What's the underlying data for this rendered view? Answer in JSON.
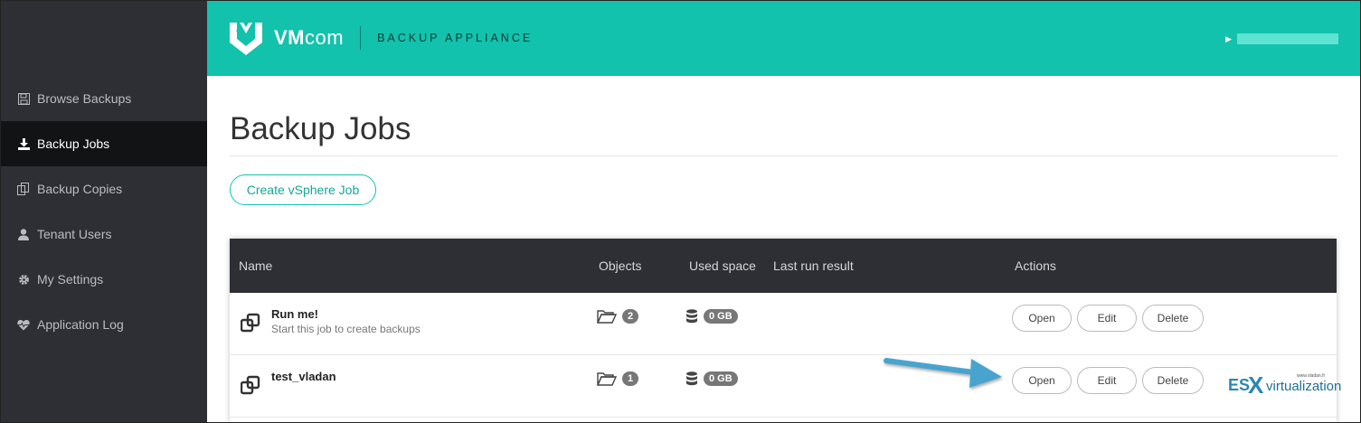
{
  "app": {
    "brand_bold": "VM",
    "brand_light": "com",
    "name": "BACKUP APPLIANCE"
  },
  "sidebar": {
    "items": [
      {
        "label": "Browse Backups",
        "icon": "floppy-icon"
      },
      {
        "label": "Backup Jobs",
        "icon": "download-icon",
        "active": true
      },
      {
        "label": "Backup Copies",
        "icon": "copy-icon"
      },
      {
        "label": "Tenant Users",
        "icon": "user-icon"
      },
      {
        "label": "My Settings",
        "icon": "gear-icon"
      },
      {
        "label": "Application Log",
        "icon": "heartbeat-icon"
      }
    ]
  },
  "page": {
    "title": "Backup Jobs",
    "create_button": "Create vSphere Job"
  },
  "table": {
    "headers": {
      "name": "Name",
      "objects": "Objects",
      "used_space": "Used space",
      "last_run": "Last run result",
      "actions": "Actions"
    },
    "rows": [
      {
        "name": "Run me!",
        "description": "Start this job to create backups",
        "objects": "2",
        "used_space": "0 GB",
        "last_run": "",
        "open": "Open",
        "edit": "Edit",
        "delete": "Delete"
      },
      {
        "name": "test_vladan",
        "description": "",
        "objects": "1",
        "used_space": "0 GB",
        "last_run": "",
        "open": "Open",
        "edit": "Edit",
        "delete": "Delete"
      }
    ]
  },
  "watermark": {
    "es": "ES",
    "x": "X",
    "rest": "virtualization",
    "small": "www.vladan.fr"
  },
  "colors": {
    "accent": "#12c2ac",
    "sidebar": "#2e2f34",
    "sidebar_active": "#121315",
    "arrow": "#4aa3cf"
  }
}
